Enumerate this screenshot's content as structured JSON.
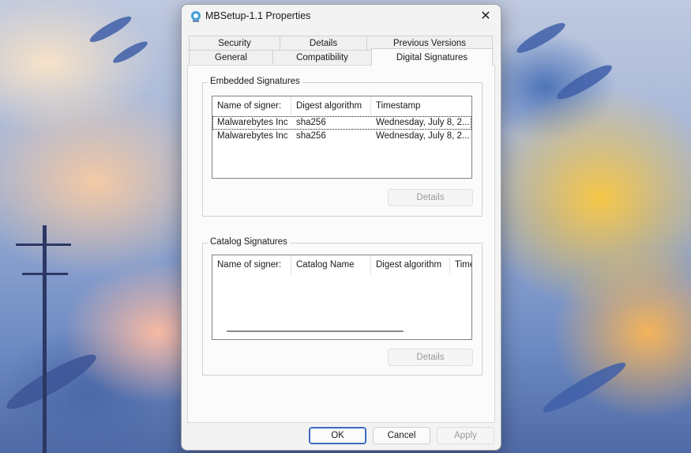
{
  "window": {
    "title": "MBSetup-1.1 Properties",
    "close_glyph": "✕"
  },
  "tabs": [
    {
      "label": "Security"
    },
    {
      "label": "Details"
    },
    {
      "label": "Previous Versions"
    },
    {
      "label": "General"
    },
    {
      "label": "Compatibility"
    },
    {
      "label": "Digital Signatures",
      "active": true
    }
  ],
  "embedded": {
    "group_label": "Embedded Signatures",
    "columns": [
      "Name of signer:",
      "Digest algorithm",
      "Timestamp"
    ],
    "rows": [
      [
        "Malwarebytes Inc",
        "sha256",
        "Wednesday, July 8, 2..."
      ],
      [
        "Malwarebytes Inc",
        "sha256",
        "Wednesday, July 8, 2..."
      ]
    ],
    "details_label": "Details"
  },
  "catalog": {
    "group_label": "Catalog Signatures",
    "columns": [
      "Name of signer:",
      "Catalog Name",
      "Digest algorithm",
      "Time"
    ],
    "details_label": "Details"
  },
  "footer": {
    "ok_label": "OK",
    "cancel_label": "Cancel",
    "apply_label": "Apply"
  },
  "colors": {
    "accent": "#3a6ac0",
    "icon": "#3fa0d8"
  }
}
